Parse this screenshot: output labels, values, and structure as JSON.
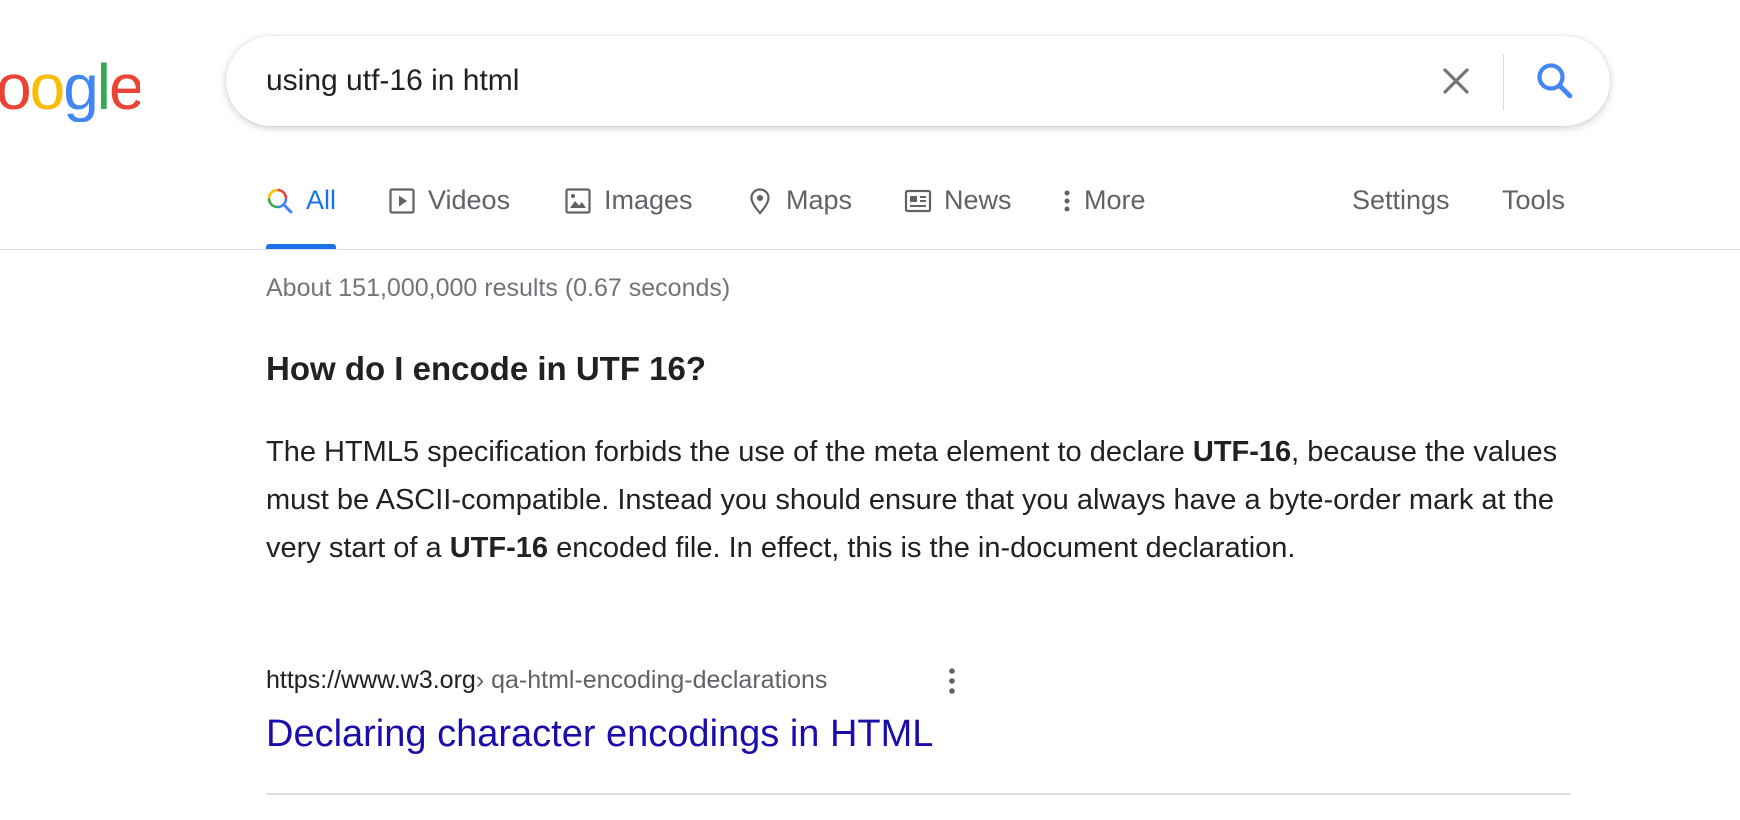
{
  "logo": {
    "letters": [
      "o",
      "o",
      "g",
      "l",
      "e"
    ]
  },
  "search": {
    "query": "using utf-16 in html",
    "clear_icon": "close-icon",
    "search_icon": "search-icon"
  },
  "tabs": [
    {
      "label": "All",
      "icon": "search-icon",
      "active": true
    },
    {
      "label": "Videos",
      "icon": "video-icon"
    },
    {
      "label": "Images",
      "icon": "image-icon"
    },
    {
      "label": "Maps",
      "icon": "map-pin-icon"
    },
    {
      "label": "News",
      "icon": "news-icon"
    },
    {
      "label": "More",
      "icon": "more-vertical-icon"
    }
  ],
  "tools": {
    "settings": "Settings",
    "tools": "Tools"
  },
  "stats": "About 151,000,000 results (0.67 seconds)",
  "featured": {
    "question": "How do I encode in UTF 16?",
    "snippet": [
      {
        "text": "The HTML5 specification forbids the use of the meta element to declare ",
        "bold": false
      },
      {
        "text": "UTF-16",
        "bold": true
      },
      {
        "text": ", because the values must be ASCII-compatible. Instead you should ensure that you always have a byte-order mark at the very start of a ",
        "bold": false
      },
      {
        "text": "UTF-16",
        "bold": true
      },
      {
        "text": " encoded file. In effect, this is the in-document declaration.",
        "bold": false
      }
    ],
    "cite_domain": "https://www.w3.org",
    "cite_path": " › qa-html-encoding-declarations",
    "title": "Declaring character encodings in HTML"
  },
  "colors": {
    "accent": "#1a73e8",
    "link": "#1a0dab",
    "text": "#202124",
    "muted": "#70757a"
  }
}
